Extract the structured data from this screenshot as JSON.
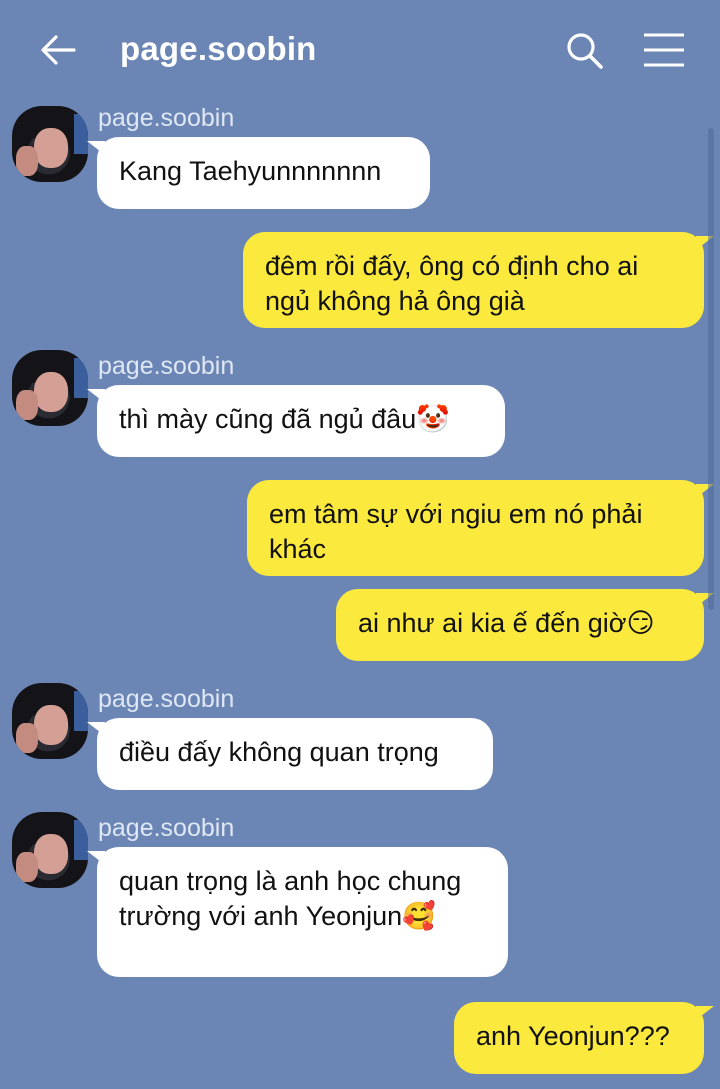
{
  "header": {
    "title": "page.soobin",
    "back_icon": "arrow-left-icon",
    "search_icon": "search-icon",
    "menu_icon": "hamburger-menu-icon"
  },
  "colors": {
    "background": "#6b86b5",
    "incoming_bubble": "#ffffff",
    "outgoing_bubble": "#fbe93e",
    "header_text": "#ffffff"
  },
  "messages": [
    {
      "direction": "in",
      "sender": "page.soobin",
      "text": "Kang Taehyunnnnnnn"
    },
    {
      "direction": "out",
      "text": "đêm rồi đấy, ông có định cho ai ngủ không hả ông già"
    },
    {
      "direction": "in",
      "sender": "page.soobin",
      "text": "thì mày cũng đã ngủ đâu🤡"
    },
    {
      "direction": "out",
      "text": "em tâm sự với ngiu em nó phải khác"
    },
    {
      "direction": "out",
      "text": "ai như ai kia ế đến giờ😏"
    },
    {
      "direction": "in",
      "sender": "page.soobin",
      "text": "điều đấy không quan trọng"
    },
    {
      "direction": "in",
      "sender": "page.soobin",
      "text": "quan trọng là anh học chung trường với anh Yeonjun🥰"
    },
    {
      "direction": "out",
      "text": "anh Yeonjun???"
    }
  ]
}
